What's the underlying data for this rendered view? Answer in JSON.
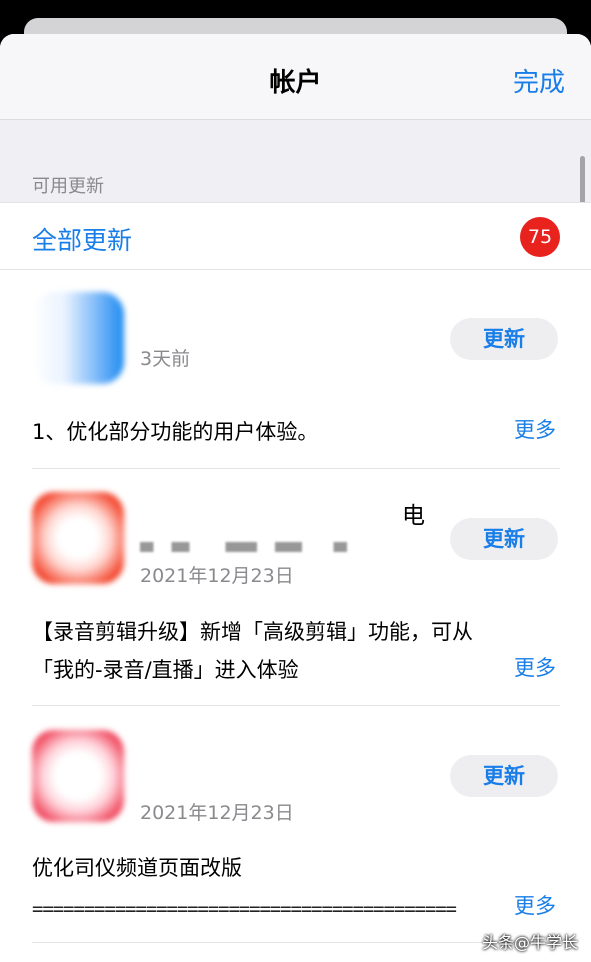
{
  "nav": {
    "title": "帐户",
    "done_label": "完成"
  },
  "section": {
    "label": "可用更新"
  },
  "update_all": {
    "label": "全部更新",
    "badge": "75"
  },
  "apps": [
    {
      "date": "3天前",
      "button": "更新",
      "notes": "1、优化部分功能的用户体验。",
      "more": "更多"
    },
    {
      "name_fragment": "电",
      "date": "2021年12月23日",
      "button": "更新",
      "notes_line1": "【录音剪辑升级】新增「高级剪辑」功能，可从",
      "notes_line2": "「我的-录音/直播」进入体验",
      "more": "更多"
    },
    {
      "date": "2021年12月23日",
      "button": "更新",
      "notes": "优化司仪频道页面改版",
      "notes_line2": "=========================================",
      "more": "更多"
    }
  ],
  "watermark": "头条@牛学长",
  "colors": {
    "accent": "#1a7ee8",
    "badge": "#e8231e"
  },
  "icons": [
    "app-icon-blue",
    "app-icon-red",
    "app-icon-pink"
  ]
}
